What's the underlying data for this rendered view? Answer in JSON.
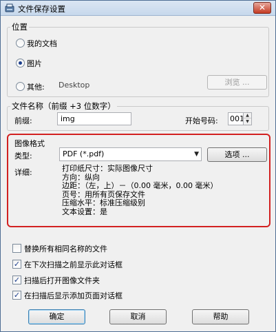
{
  "window": {
    "title": "文件保存设置",
    "close_glyph": "✕",
    "icon": "scanner-app-icon"
  },
  "location": {
    "legend": "位置",
    "options": [
      {
        "label": "我的文档",
        "checked": false
      },
      {
        "label": "图片",
        "checked": true
      },
      {
        "label": "其他:",
        "checked": false,
        "value": "Desktop"
      }
    ],
    "browse_label": "浏览 ..."
  },
  "file_name": {
    "legend": "文件名称（前缀 +3 位数字）",
    "prefix_label": "前缀:",
    "prefix_value": "img",
    "start_label": "开始号码:",
    "start_value": "001"
  },
  "image_format": {
    "legend": "图像格式",
    "type_label": "类型:",
    "type_value": "PDF (*.pdf)",
    "options_label": "选项 ...",
    "details_label": "详细:",
    "details": [
      "打印纸尺寸：实际图像尺寸",
      "方向：纵向",
      "边距：（左，上）－（0.00 毫米，0.00 毫米）",
      "页号：用所有页保存文件",
      "压缩水平：标准压缩级别",
      "文本设置：是"
    ],
    "highlight_color": "#d22020"
  },
  "checkboxes": [
    {
      "label": "替换所有相同名称的文件",
      "checked": false
    },
    {
      "label": "在下次扫描之前显示此对话框",
      "checked": true
    },
    {
      "label": "扫描后打开图像文件夹",
      "checked": true
    },
    {
      "label": "在扫描后显示添加页面对话框",
      "checked": true
    }
  ],
  "buttons": {
    "ok": "确定",
    "cancel": "取消",
    "help": "帮助"
  }
}
